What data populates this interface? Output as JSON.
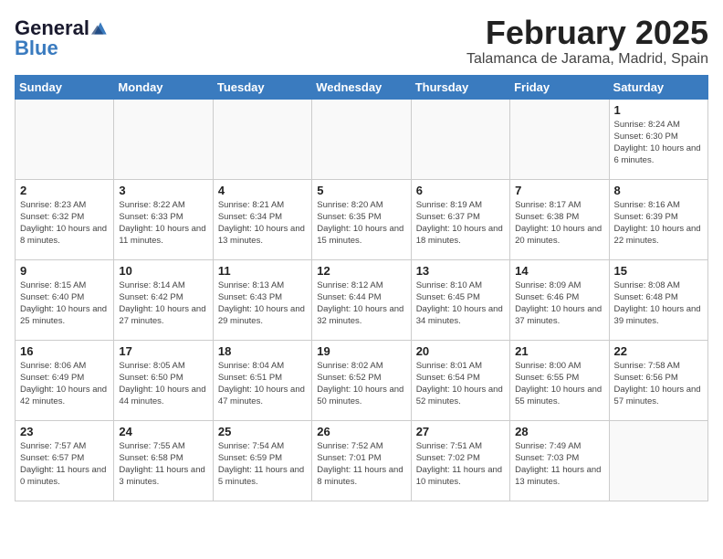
{
  "header": {
    "logo_line1": "General",
    "logo_line2": "Blue",
    "title": "February 2025",
    "subtitle": "Talamanca de Jarama, Madrid, Spain"
  },
  "weekdays": [
    "Sunday",
    "Monday",
    "Tuesday",
    "Wednesday",
    "Thursday",
    "Friday",
    "Saturday"
  ],
  "weeks": [
    [
      {
        "day": "",
        "info": ""
      },
      {
        "day": "",
        "info": ""
      },
      {
        "day": "",
        "info": ""
      },
      {
        "day": "",
        "info": ""
      },
      {
        "day": "",
        "info": ""
      },
      {
        "day": "",
        "info": ""
      },
      {
        "day": "1",
        "info": "Sunrise: 8:24 AM\nSunset: 6:30 PM\nDaylight: 10 hours\nand 6 minutes."
      }
    ],
    [
      {
        "day": "2",
        "info": "Sunrise: 8:23 AM\nSunset: 6:32 PM\nDaylight: 10 hours\nand 8 minutes."
      },
      {
        "day": "3",
        "info": "Sunrise: 8:22 AM\nSunset: 6:33 PM\nDaylight: 10 hours\nand 11 minutes."
      },
      {
        "day": "4",
        "info": "Sunrise: 8:21 AM\nSunset: 6:34 PM\nDaylight: 10 hours\nand 13 minutes."
      },
      {
        "day": "5",
        "info": "Sunrise: 8:20 AM\nSunset: 6:35 PM\nDaylight: 10 hours\nand 15 minutes."
      },
      {
        "day": "6",
        "info": "Sunrise: 8:19 AM\nSunset: 6:37 PM\nDaylight: 10 hours\nand 18 minutes."
      },
      {
        "day": "7",
        "info": "Sunrise: 8:17 AM\nSunset: 6:38 PM\nDaylight: 10 hours\nand 20 minutes."
      },
      {
        "day": "8",
        "info": "Sunrise: 8:16 AM\nSunset: 6:39 PM\nDaylight: 10 hours\nand 22 minutes."
      }
    ],
    [
      {
        "day": "9",
        "info": "Sunrise: 8:15 AM\nSunset: 6:40 PM\nDaylight: 10 hours\nand 25 minutes."
      },
      {
        "day": "10",
        "info": "Sunrise: 8:14 AM\nSunset: 6:42 PM\nDaylight: 10 hours\nand 27 minutes."
      },
      {
        "day": "11",
        "info": "Sunrise: 8:13 AM\nSunset: 6:43 PM\nDaylight: 10 hours\nand 29 minutes."
      },
      {
        "day": "12",
        "info": "Sunrise: 8:12 AM\nSunset: 6:44 PM\nDaylight: 10 hours\nand 32 minutes."
      },
      {
        "day": "13",
        "info": "Sunrise: 8:10 AM\nSunset: 6:45 PM\nDaylight: 10 hours\nand 34 minutes."
      },
      {
        "day": "14",
        "info": "Sunrise: 8:09 AM\nSunset: 6:46 PM\nDaylight: 10 hours\nand 37 minutes."
      },
      {
        "day": "15",
        "info": "Sunrise: 8:08 AM\nSunset: 6:48 PM\nDaylight: 10 hours\nand 39 minutes."
      }
    ],
    [
      {
        "day": "16",
        "info": "Sunrise: 8:06 AM\nSunset: 6:49 PM\nDaylight: 10 hours\nand 42 minutes."
      },
      {
        "day": "17",
        "info": "Sunrise: 8:05 AM\nSunset: 6:50 PM\nDaylight: 10 hours\nand 44 minutes."
      },
      {
        "day": "18",
        "info": "Sunrise: 8:04 AM\nSunset: 6:51 PM\nDaylight: 10 hours\nand 47 minutes."
      },
      {
        "day": "19",
        "info": "Sunrise: 8:02 AM\nSunset: 6:52 PM\nDaylight: 10 hours\nand 50 minutes."
      },
      {
        "day": "20",
        "info": "Sunrise: 8:01 AM\nSunset: 6:54 PM\nDaylight: 10 hours\nand 52 minutes."
      },
      {
        "day": "21",
        "info": "Sunrise: 8:00 AM\nSunset: 6:55 PM\nDaylight: 10 hours\nand 55 minutes."
      },
      {
        "day": "22",
        "info": "Sunrise: 7:58 AM\nSunset: 6:56 PM\nDaylight: 10 hours\nand 57 minutes."
      }
    ],
    [
      {
        "day": "23",
        "info": "Sunrise: 7:57 AM\nSunset: 6:57 PM\nDaylight: 11 hours\nand 0 minutes."
      },
      {
        "day": "24",
        "info": "Sunrise: 7:55 AM\nSunset: 6:58 PM\nDaylight: 11 hours\nand 3 minutes."
      },
      {
        "day": "25",
        "info": "Sunrise: 7:54 AM\nSunset: 6:59 PM\nDaylight: 11 hours\nand 5 minutes."
      },
      {
        "day": "26",
        "info": "Sunrise: 7:52 AM\nSunset: 7:01 PM\nDaylight: 11 hours\nand 8 minutes."
      },
      {
        "day": "27",
        "info": "Sunrise: 7:51 AM\nSunset: 7:02 PM\nDaylight: 11 hours\nand 10 minutes."
      },
      {
        "day": "28",
        "info": "Sunrise: 7:49 AM\nSunset: 7:03 PM\nDaylight: 11 hours\nand 13 minutes."
      },
      {
        "day": "",
        "info": ""
      }
    ]
  ]
}
